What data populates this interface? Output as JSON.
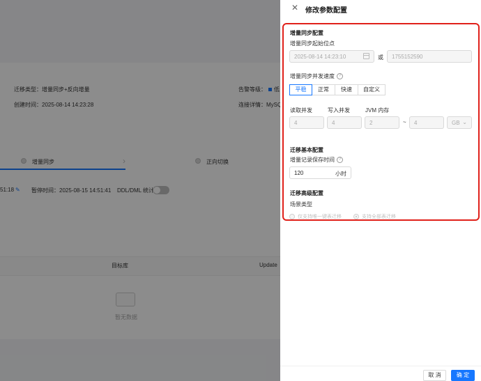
{
  "background": {
    "migration_type": "迁移类型：增量同步+反向增量",
    "created_time": "创建时间：2025-08-14 14:23:28",
    "alert_level": "告警等级：",
    "alert_level_value": "低",
    "connection_details": "连接详情：MySQ",
    "step_incremental": "增量同步",
    "step_forward_switch": "正向切换",
    "time_fragment": "51:18",
    "pause_time": "暂停时间：2025-08-15 14:51:41",
    "ddl_dml_stats": "DDL/DML 统计：",
    "col_target": "目标库",
    "col_update": "Update",
    "empty_text": "暂无数据"
  },
  "drawer": {
    "title": "修改参数配置",
    "close_icon": "close-icon",
    "incremental_section": {
      "title": "增量同步配置",
      "start_point_label": "增量同步起始位点",
      "start_datetime_placeholder": "2025-08-14 14:23:10",
      "or_text": "或",
      "timestamp_placeholder": "1755152590",
      "speed_label": "增量同步并发速度",
      "speed_options": [
        "平稳",
        "正常",
        "快速",
        "自定义"
      ],
      "speed_selected": "平稳",
      "read_concurrency_label": "读取并发",
      "write_concurrency_label": "写入并发",
      "jvm_memory_label": "JVM 内存",
      "read_value": "4",
      "write_value": "4",
      "jvm_min": "2",
      "range_sep": "~",
      "jvm_max": "4",
      "jvm_unit": "GB"
    },
    "basic_section": {
      "title": "迁移基本配置",
      "retention_label": "增量记录保存时间",
      "retention_value": "120",
      "retention_unit": "小时"
    },
    "advanced_section": {
      "title": "迁移高级配置",
      "scenario_label": "场景类型",
      "scenario_options": [
        "仅支持唯一键表迁移",
        "支持全部表迁移"
      ],
      "scenario_selected": "支持全部表迁移"
    },
    "footer": {
      "cancel_label": "取 消",
      "ok_label": "确 定"
    }
  },
  "colors": {
    "primary": "#1677ff",
    "highlight_border": "#e0201a",
    "mask": "rgba(0,0,0,0.45)"
  }
}
